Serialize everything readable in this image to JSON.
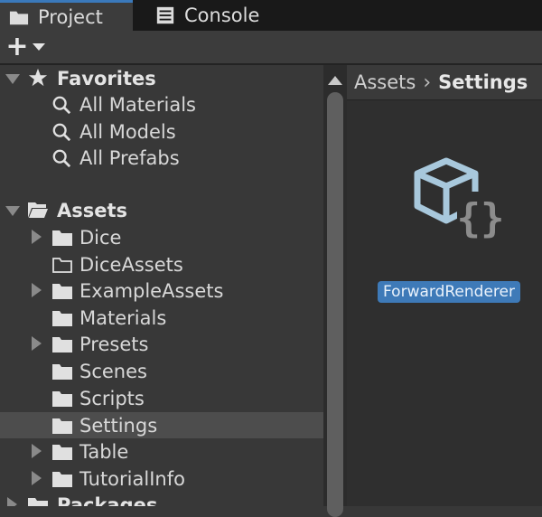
{
  "tabs": [
    {
      "label": "Project",
      "icon": "folder-icon",
      "active": true
    },
    {
      "label": "Console",
      "icon": "console-icon",
      "active": false
    }
  ],
  "toolbar": {
    "add_label": "+"
  },
  "tree": {
    "favorites": {
      "label": "Favorites",
      "items": [
        "All Materials",
        "All Models",
        "All Prefabs"
      ]
    },
    "assets": {
      "label": "Assets",
      "items": [
        {
          "label": "Dice",
          "expandable": true,
          "filled": true
        },
        {
          "label": "DiceAssets",
          "expandable": false,
          "filled": false
        },
        {
          "label": "ExampleAssets",
          "expandable": true,
          "filled": true
        },
        {
          "label": "Materials",
          "expandable": false,
          "filled": true
        },
        {
          "label": "Presets",
          "expandable": true,
          "filled": true
        },
        {
          "label": "Scenes",
          "expandable": false,
          "filled": true
        },
        {
          "label": "Scripts",
          "expandable": false,
          "filled": true
        },
        {
          "label": "Settings",
          "expandable": false,
          "filled": true,
          "selected": true
        },
        {
          "label": "Table",
          "expandable": true,
          "filled": true
        },
        {
          "label": "TutorialInfo",
          "expandable": true,
          "filled": true
        }
      ]
    },
    "packages": {
      "label": "Packages"
    }
  },
  "breadcrumb": {
    "root": "Assets",
    "current": "Settings"
  },
  "content": {
    "asset_label": "ForwardRenderer"
  },
  "colors": {
    "accent": "#3a79bb",
    "selected_row": "#4d4d4d",
    "asset_label_bg": "#3e7ab8"
  }
}
